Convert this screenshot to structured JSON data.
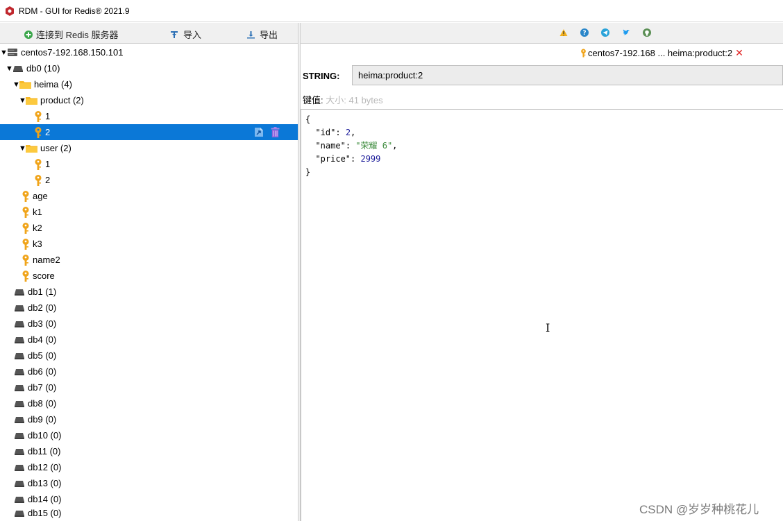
{
  "window": {
    "title": "RDM - GUI for Redis® 2021.9"
  },
  "left_toolbar": {
    "connect_label": "连接到 Redis 服务器",
    "import_label": "导入",
    "export_label": "导出"
  },
  "right_toolbar": {
    "icons": [
      "warning-icon",
      "help-icon",
      "telegram-icon",
      "twitter-icon",
      "github-icon"
    ]
  },
  "tree": {
    "server": {
      "label": "centos7-192.168.150.101"
    },
    "db0": {
      "label": "db0",
      "count": "(10)"
    },
    "heima": {
      "label": "heima (4)"
    },
    "product": {
      "label": "product (2)"
    },
    "product_keys": [
      "1",
      "2"
    ],
    "user": {
      "label": "user (2)"
    },
    "user_keys": [
      "1",
      "2"
    ],
    "root_keys": [
      "age",
      "k1",
      "k2",
      "k3",
      "name2",
      "score"
    ],
    "dbs": [
      {
        "label": "db1",
        "count": "(1)"
      },
      {
        "label": "db2",
        "count": "(0)"
      },
      {
        "label": "db3",
        "count": "(0)"
      },
      {
        "label": "db4",
        "count": "(0)"
      },
      {
        "label": "db5",
        "count": "(0)"
      },
      {
        "label": "db6",
        "count": "(0)"
      },
      {
        "label": "db7",
        "count": "(0)"
      },
      {
        "label": "db8",
        "count": "(0)"
      },
      {
        "label": "db9",
        "count": "(0)"
      },
      {
        "label": "db10",
        "count": "(0)"
      },
      {
        "label": "db11",
        "count": "(0)"
      },
      {
        "label": "db12",
        "count": "(0)"
      },
      {
        "label": "db13",
        "count": "(0)"
      },
      {
        "label": "db14",
        "count": "(0)"
      },
      {
        "label": "db15",
        "count": "(0)"
      }
    ]
  },
  "tab": {
    "label": "centos7-192.168 ... heima:product:2",
    "close": "✕"
  },
  "key_view": {
    "type": "STRING:",
    "key_name": "heima:product:2",
    "value_label": "键值:",
    "size_label": "大小:",
    "size_value": "41 bytes"
  },
  "value_json": {
    "open": "{",
    "id_key": "\"id\"",
    "id_val": "2",
    "name_key": "\"name\"",
    "name_val": "\"荣耀 6\"",
    "price_key": "\"price\"",
    "price_val": "2999",
    "close": "}"
  },
  "watermark": "CSDN @岁岁种桃花儿",
  "colors": {
    "selection": "#0b78d7",
    "key_icon": "#f0a41a",
    "folder_icon": "#f7b928",
    "json_string": "#3c8b3c"
  }
}
